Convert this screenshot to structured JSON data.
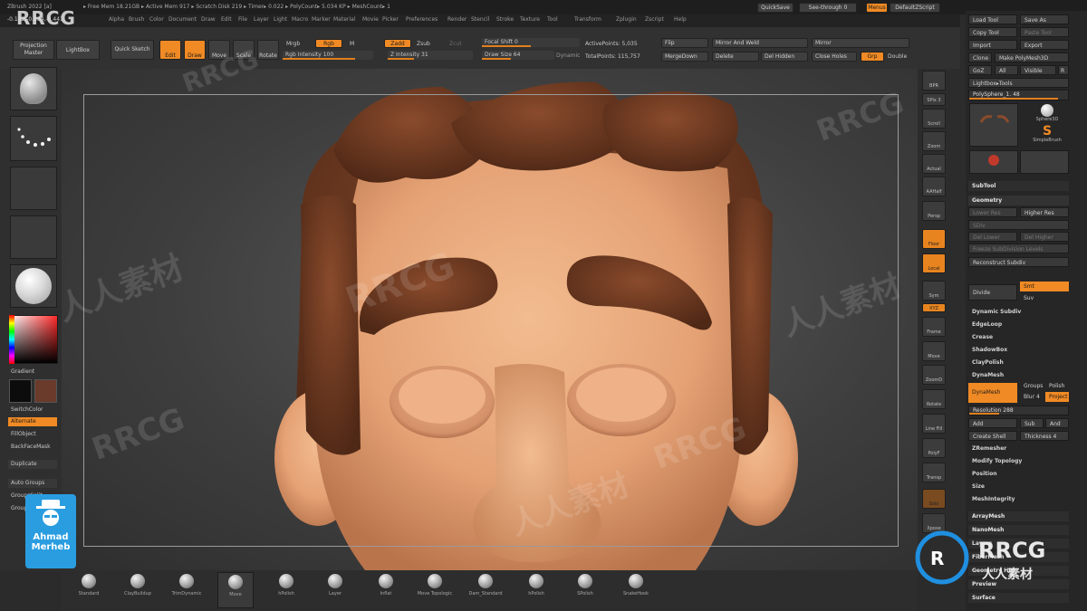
{
  "window": {
    "title": "ZBrush 2022 [a]",
    "status": "▸ Free Mem 18.21GB ▸ Active Mem 917 ▸ Scratch Disk 219 ▸ Timer▸ 0.022 ▸ PolyCount▸ 5.034 KP ▸ MeshCount▸ 1",
    "quicksave": "QuickSave",
    "see_through": "See-through 0",
    "menus_label": "Menus",
    "default_zscript": "DefaultZScript"
  },
  "menubar": [
    "Alpha",
    "Brush",
    "Color",
    "Document",
    "Draw",
    "Edit",
    "File",
    "Layer",
    "Light",
    "Macro",
    "Marker",
    "Material",
    "Movie",
    "Picker",
    "Preferences",
    "Render",
    "Stencil",
    "Stroke",
    "Texture",
    "Tool",
    "Transform",
    "Zplugin",
    "Zscript",
    "Help"
  ],
  "coords": "-0.142,-0.134,-0.441",
  "topshelf": {
    "projection_master": "Projection Master",
    "lightbox": "LightBox",
    "quick_sketch": "Quick Sketch",
    "edit": "Edit",
    "draw": "Draw",
    "move": "Move",
    "scale": "Scale",
    "rotate": "Rotate",
    "mrgb": "Mrgb",
    "rgb": "Rgb",
    "m": "M",
    "rgb_intensity": "Rgb Intensity 100",
    "zadd": "Zadd",
    "zsub": "Zsub",
    "zcut": "Zcut",
    "z_intensity": "Z Intensity 31",
    "focal_shift": "Focal Shift 0",
    "draw_size": "Draw Size 64",
    "dynamic": "Dynamic",
    "active_points": "ActivePoints: 5,035",
    "total_points": "TotalPoints: 115,757",
    "flip": "Flip",
    "mirror_and_weld": "Mirror And Weld",
    "mirror": "Mirror",
    "merge_down": "MergeDown",
    "delete": "Delete",
    "del_hidden": "Del Hidden",
    "close_holes": "Close Holes",
    "grp": "Grp",
    "double": "Double"
  },
  "leftshelf": {
    "gradient": "Gradient",
    "switch_color": "SwitchColor",
    "alternate": "Alternate",
    "fill_object": "FillObject",
    "backface_mask": "BackFaceMask",
    "duplicate": "Duplicate",
    "auto_groups": "Auto Groups",
    "groups_split": "GroupsSplit",
    "group_visible": "GroupVisible"
  },
  "rightshelf": [
    "BPR",
    "SPix 3",
    "Scroll",
    "Zoom",
    "Actual",
    "AAHalf",
    "Persp",
    "Floor",
    "Local",
    "Sym",
    "Frame",
    "Move",
    "ZoomD",
    "Rotate",
    "Line Fill",
    "PolyF",
    "Transp",
    "Solo",
    "Xpose"
  ],
  "palette": {
    "load_tool": "Load Tool",
    "save_as": "Save As",
    "copy_tool": "Copy Tool",
    "paste_tool": "Paste Tool",
    "import": "Import",
    "export": "Export",
    "clone": "Clone",
    "make_polymesh3d": "Make PolyMesh3D",
    "goz": "GoZ",
    "all": "All",
    "visible": "Visible",
    "r": "R",
    "lightbox_tools": "Lightbox▸Tools",
    "polysphere": "PolySphere_1. 48",
    "sphere3d": "Sphere3D",
    "simplebrush": "SimpleBrush",
    "subtool": "SubTool",
    "geometry": "Geometry",
    "lower_res": "Lower Res",
    "higher_res": "Higher Res",
    "sdiv": "SDiv",
    "del_lower": "Del Lower",
    "del_higher": "Del Higher",
    "freeze_subdivision": "Freeze SubDivision Levels",
    "reconstruct_subdiv": "Reconstruct Subdiv",
    "divide": "Divide",
    "smt": "Smt",
    "suv": "Suv",
    "dynamic_subdiv": "Dynamic Subdiv",
    "edgeloop": "EdgeLoop",
    "crease": "Crease",
    "shadowbox": "ShadowBox",
    "claypolish": "ClayPolish",
    "dynamesh_head": "DynaMesh",
    "dynamesh_btn": "DynaMesh",
    "groups": "Groups",
    "polish": "Polish",
    "blur": "Blur 4",
    "project": "Project",
    "resolution": "Resolution 288",
    "add": "Add",
    "sub": "Sub",
    "and": "And",
    "create_shell": "Create Shell",
    "thickness": "Thickness 4",
    "zremesher": "ZRemesher",
    "modify_topology": "Modify Topology",
    "position": "Position",
    "size": "Size",
    "mesh_integrity": "MeshIntegrity",
    "arraymesh": "ArrayMesh",
    "nanomesh": "NanoMesh",
    "layers": "Layers",
    "fibermesh": "FiberMesh",
    "geometry_hd": "Geometry HD",
    "preview": "Preview",
    "surface": "Surface"
  },
  "brushes": [
    "Standard",
    "ClayBuildup",
    "TrimDynamic",
    "Move",
    "hPolish",
    "Layer",
    "Inflat",
    "Move Topologic",
    "Dam_Standard",
    "hPolish",
    "SPolish",
    "SnakeHook"
  ],
  "brand": {
    "logo_text": "RRCG",
    "logo_sub": "人人素材",
    "author_line1": "Ahmad",
    "author_line2": "Merheb",
    "watermark_en": "RRCG",
    "watermark_cn": "人人素材"
  },
  "colors": {
    "accent": "#f08a24",
    "skin": "#e9a97c",
    "hair": "#6f3a22",
    "background": "#2b2b2b",
    "palette": "#262626"
  }
}
